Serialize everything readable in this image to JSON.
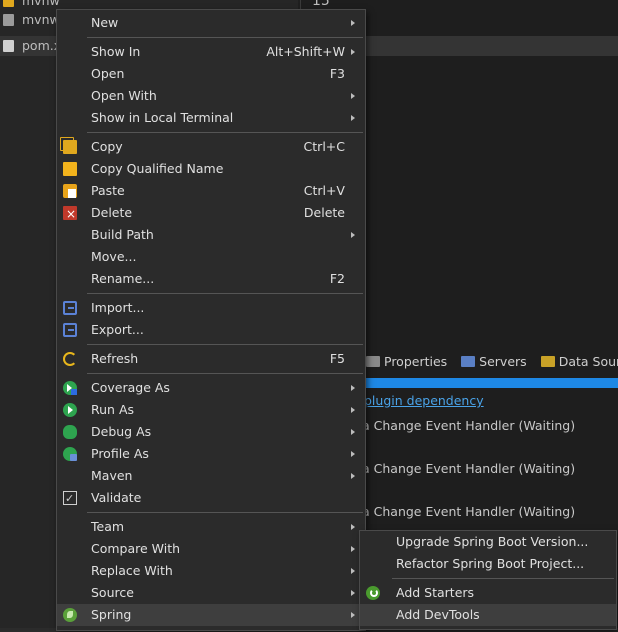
{
  "explorer": {
    "files": [
      {
        "name": "mvnw",
        "icon": "file-icon"
      },
      {
        "name": "mvnw",
        "icon": "cmd-file-icon"
      },
      {
        "name": "pom.x",
        "icon": "pom-file-icon"
      }
    ]
  },
  "editor": {
    "line_number": "15"
  },
  "views": {
    "tabs": [
      {
        "label": "Properties",
        "icon": "properties-icon"
      },
      {
        "label": "Servers",
        "icon": "servers-icon"
      },
      {
        "label": "Data Source E",
        "icon": "data-source-icon"
      }
    ],
    "link_text": "plugin dependency",
    "jobs": [
      "a Change Event Handler (Waiting)",
      "a Change Event Handler (Waiting)",
      "a Change Event Handler (Waiting)"
    ]
  },
  "context_menu": {
    "items": [
      {
        "label": "New",
        "accel": "",
        "submenu": true,
        "icon": ""
      },
      {
        "label": "Show In",
        "accel": "Alt+Shift+W",
        "submenu": true,
        "icon": ""
      },
      {
        "label": "Open",
        "accel": "F3",
        "submenu": false,
        "icon": ""
      },
      {
        "label": "Open With",
        "accel": "",
        "submenu": true,
        "icon": ""
      },
      {
        "label": "Show in Local Terminal",
        "accel": "",
        "submenu": true,
        "icon": ""
      },
      {
        "label": "Copy",
        "accel": "Ctrl+C",
        "submenu": false,
        "icon": "copy-icon"
      },
      {
        "label": "Copy Qualified Name",
        "accel": "",
        "submenu": false,
        "icon": "copy-qualified-name-icon"
      },
      {
        "label": "Paste",
        "accel": "Ctrl+V",
        "submenu": false,
        "icon": "paste-icon"
      },
      {
        "label": "Delete",
        "accel": "Delete",
        "submenu": false,
        "icon": "delete-icon"
      },
      {
        "label": "Build Path",
        "accel": "",
        "submenu": true,
        "icon": ""
      },
      {
        "label": "Move...",
        "accel": "",
        "submenu": false,
        "icon": ""
      },
      {
        "label": "Rename...",
        "accel": "F2",
        "submenu": false,
        "icon": ""
      },
      {
        "label": "Import...",
        "accel": "",
        "submenu": false,
        "icon": "import-icon"
      },
      {
        "label": "Export...",
        "accel": "",
        "submenu": false,
        "icon": "export-icon"
      },
      {
        "label": "Refresh",
        "accel": "F5",
        "submenu": false,
        "icon": "refresh-icon"
      },
      {
        "label": "Coverage As",
        "accel": "",
        "submenu": true,
        "icon": "coverage-icon"
      },
      {
        "label": "Run As",
        "accel": "",
        "submenu": true,
        "icon": "run-icon"
      },
      {
        "label": "Debug As",
        "accel": "",
        "submenu": true,
        "icon": "debug-icon"
      },
      {
        "label": "Profile As",
        "accel": "",
        "submenu": true,
        "icon": "profile-icon"
      },
      {
        "label": "Maven",
        "accel": "",
        "submenu": true,
        "icon": ""
      },
      {
        "label": "Validate",
        "accel": "",
        "submenu": false,
        "icon": "validate-checkbox-icon"
      },
      {
        "label": "Team",
        "accel": "",
        "submenu": true,
        "icon": ""
      },
      {
        "label": "Compare With",
        "accel": "",
        "submenu": true,
        "icon": ""
      },
      {
        "label": "Replace With",
        "accel": "",
        "submenu": true,
        "icon": ""
      },
      {
        "label": "Source",
        "accel": "",
        "submenu": true,
        "icon": ""
      },
      {
        "label": "Spring",
        "accel": "",
        "submenu": true,
        "icon": "spring-icon"
      }
    ]
  },
  "spring_submenu": {
    "items": [
      {
        "label": "Upgrade Spring Boot Version...",
        "icon": ""
      },
      {
        "label": "Refactor Spring Boot Project...",
        "icon": ""
      },
      {
        "label": "Add Starters",
        "icon": "spring-boot-icon"
      },
      {
        "label": "Add DevTools",
        "icon": ""
      }
    ]
  },
  "colors": {
    "menu_bg": "#2b2b2b",
    "highlight": "#3e3e3e",
    "progress": "#1e88e5",
    "link": "#4aa3e8"
  }
}
